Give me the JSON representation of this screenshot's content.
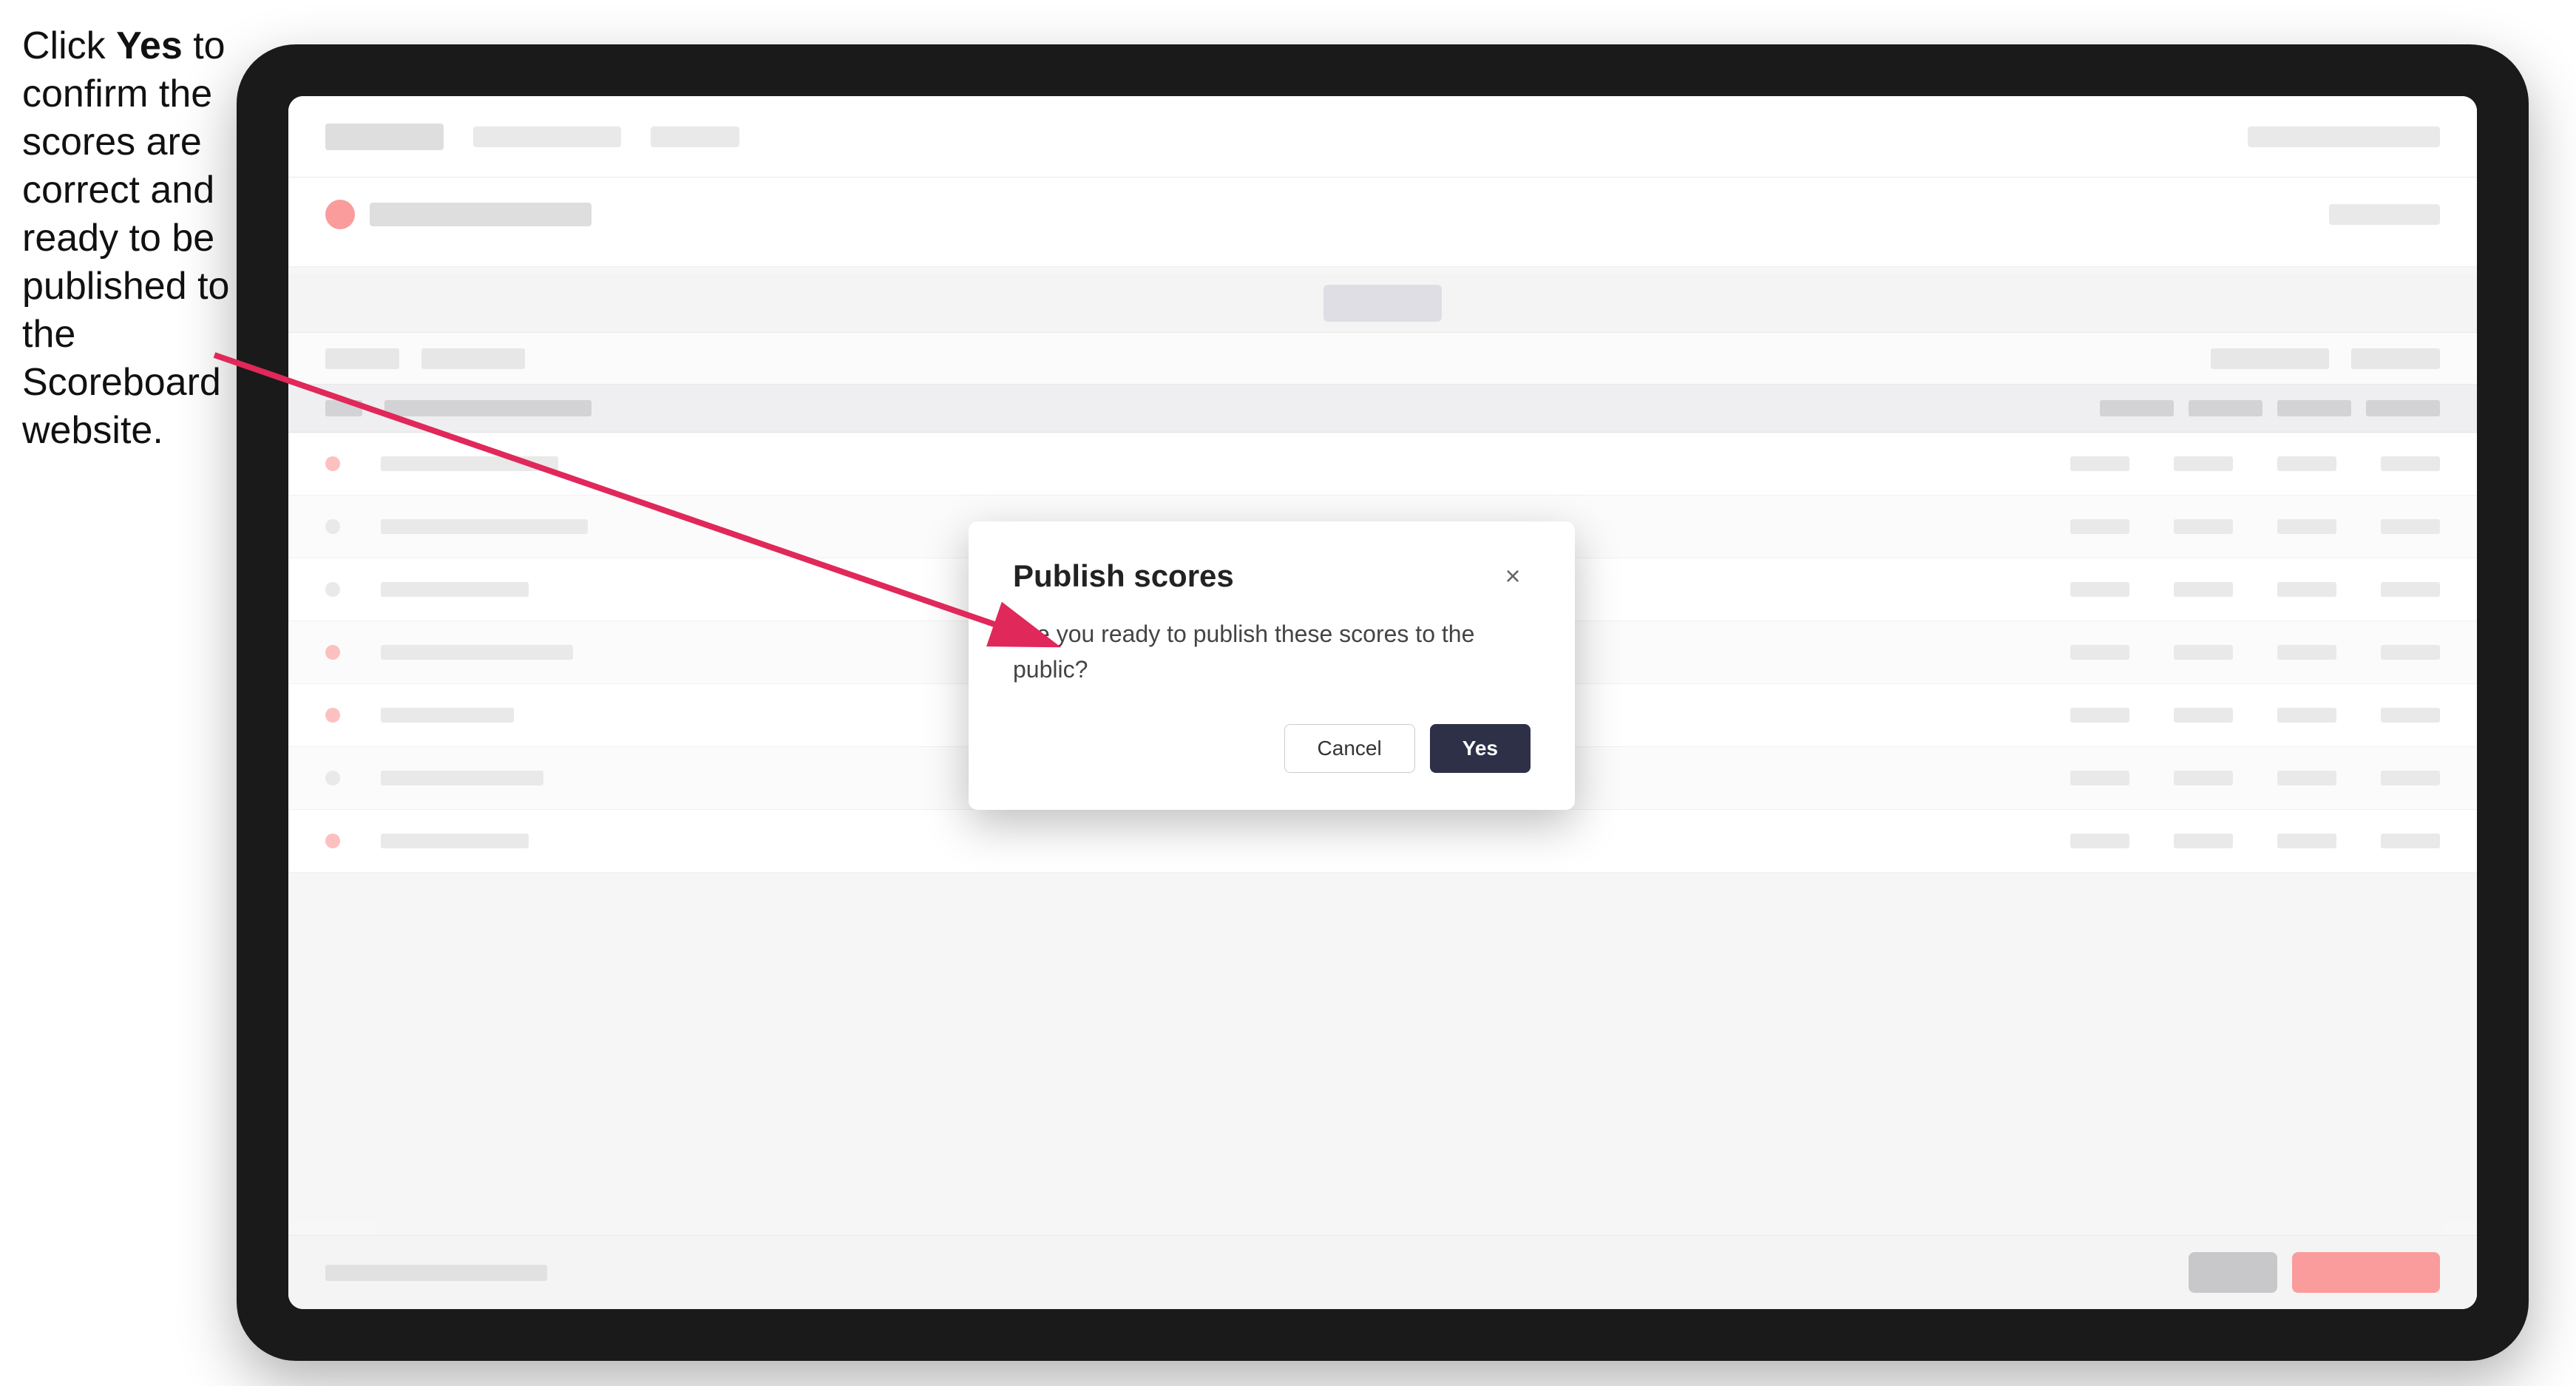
{
  "instruction": {
    "text_part1": "Click ",
    "bold": "Yes",
    "text_part2": " to confirm the scores are correct and ready to be published to the Scoreboard website."
  },
  "modal": {
    "title": "Publish scores",
    "body_text": "Are you ready to publish these scores to the public?",
    "cancel_label": "Cancel",
    "yes_label": "Yes",
    "close_icon": "×"
  },
  "arrow": {
    "color": "#e0285a"
  }
}
